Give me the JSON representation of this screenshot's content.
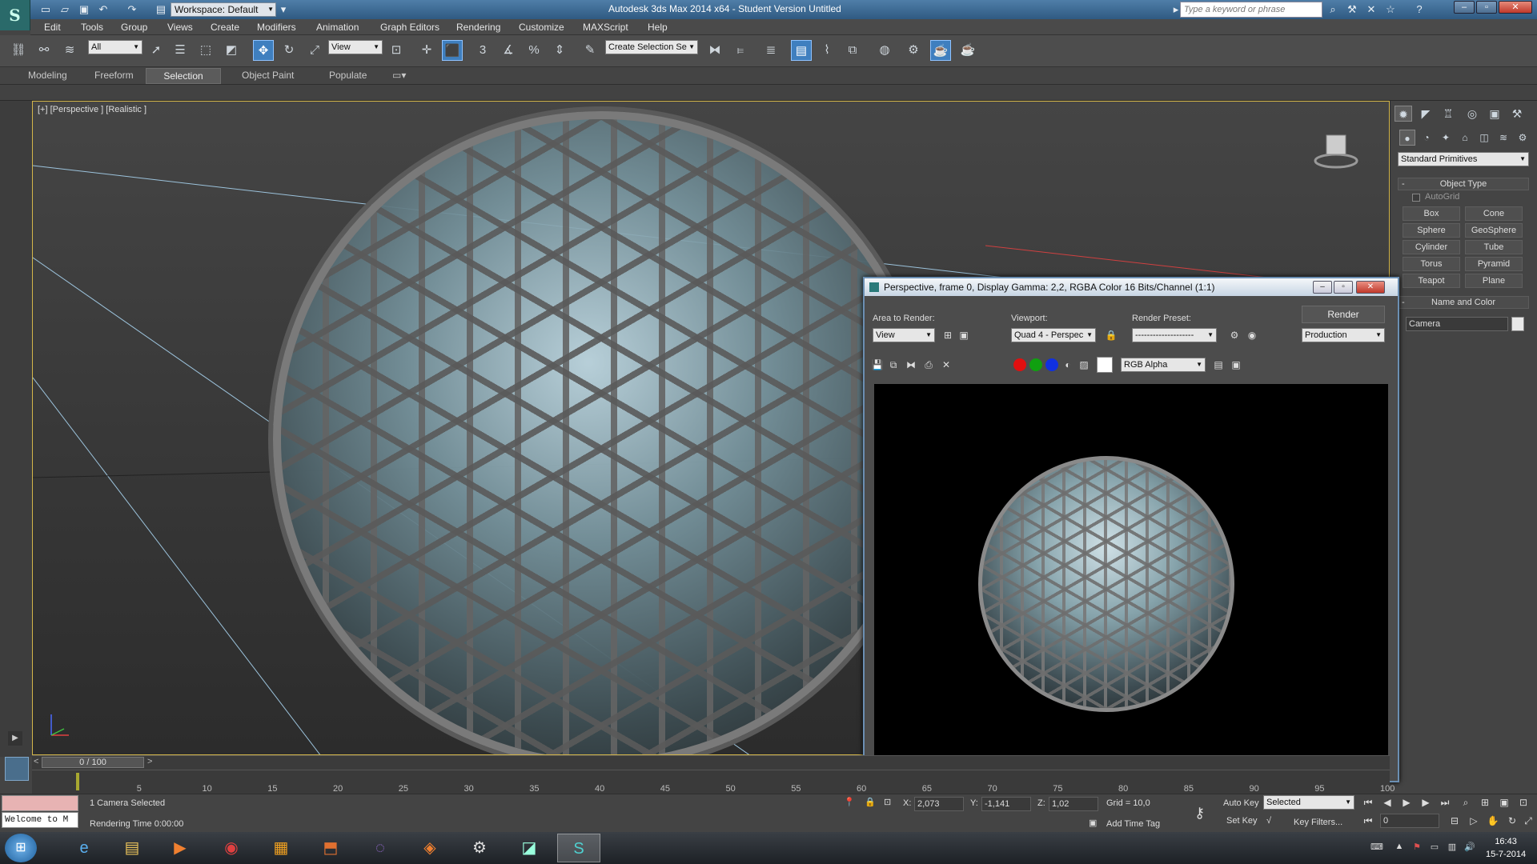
{
  "title_bar": {
    "title": "Autodesk 3ds Max  2014 x64    - Student Version    Untitled",
    "workspace": "Workspace: Default",
    "search_placeholder": "Type a keyword or phrase"
  },
  "menu": [
    "Edit",
    "Tools",
    "Group",
    "Views",
    "Create",
    "Modifiers",
    "Animation",
    "Graph Editors",
    "Rendering",
    "Customize",
    "MAXScript",
    "Help"
  ],
  "toolbar": {
    "filter": "All",
    "ref_coord": "View",
    "angle_snap_label": "3",
    "selection_set_placeholder": "Create Selection Se"
  },
  "ribbon": {
    "tabs": [
      "Modeling",
      "Freeform",
      "Selection",
      "Object Paint",
      "Populate"
    ],
    "active": "Selection"
  },
  "viewport": {
    "label": "[+] [Perspective ] [Realistic ]"
  },
  "command_panel": {
    "category": "Standard Primitives",
    "object_type_header": "Object Type",
    "autogrid": "AutoGrid",
    "buttons": [
      "Box",
      "Cone",
      "Sphere",
      "GeoSphere",
      "Cylinder",
      "Tube",
      "Torus",
      "Pyramid",
      "Teapot",
      "Plane"
    ],
    "name_color_header": "Name and Color",
    "name_value": "Camera"
  },
  "render_window": {
    "title": "Perspective, frame 0, Display Gamma: 2,2, RGBA Color 16 Bits/Channel (1:1)",
    "area_label": "Area to Render:",
    "area_value": "View",
    "viewport_label": "Viewport:",
    "viewport_value": "Quad 4 - Perspec",
    "preset_label": "Render Preset:",
    "preset_value": "--------------------",
    "render_button": "Render",
    "mode_value": "Production",
    "channel_value": "RGB Alpha",
    "channel_colors": [
      "#e01010",
      "#10a010",
      "#1030e0"
    ]
  },
  "timeline": {
    "frame_display": "0 / 100",
    "ticks": [
      "5",
      "10",
      "15",
      "20",
      "25",
      "30",
      "35",
      "40",
      "45",
      "50",
      "55",
      "60",
      "65",
      "70",
      "75",
      "80",
      "85",
      "90",
      "95",
      "100"
    ]
  },
  "status": {
    "listener_text": "Welcome to M",
    "selection": "1 Camera Selected",
    "rendering_time": "Rendering Time  0:00:00",
    "x_label": "X:",
    "x_value": "2,073",
    "y_label": "Y:",
    "y_value": "-1,141",
    "z_label": "Z:",
    "z_value": "1,02",
    "grid": "Grid = 10,0",
    "add_time_tag": "Add Time Tag",
    "auto_key": "Auto Key",
    "set_key": "Set Key",
    "key_mode": "Selected",
    "key_filters": "Key Filters...",
    "frame": "0"
  },
  "taskbar": {
    "time": "16:43",
    "date": "15-7-2014"
  }
}
